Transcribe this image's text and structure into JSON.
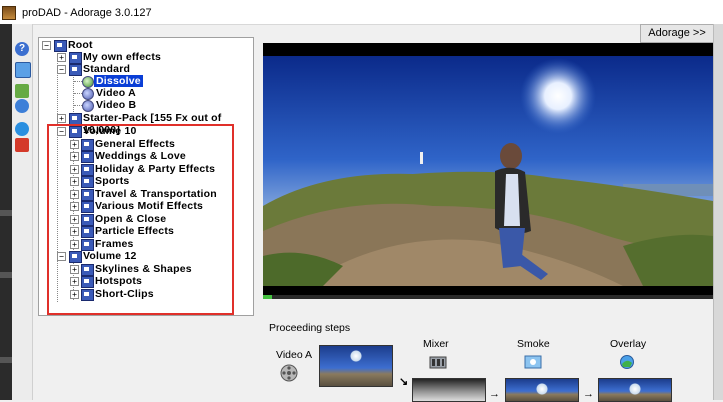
{
  "window": {
    "title": "proDAD - Adorage 3.0.127"
  },
  "toolbar": {
    "adorage_button": "Adorage >>"
  },
  "tree": {
    "root": "Root",
    "my_own_effects": "My own effects",
    "standard": "Standard",
    "dissolve": "Dissolve",
    "video_a": "Video A",
    "video_b": "Video B",
    "starter_pack": "Starter-Pack [155 Fx out of 10,000]",
    "volume10": "Volume 10",
    "volume10_items": [
      "General Effects",
      "Weddings & Love",
      "Holiday & Party Effects",
      "Sports",
      "Travel & Transportation",
      "Various Motif Effects",
      "Open & Close",
      "Particle Effects",
      "Frames"
    ],
    "volume12": "Volume 12",
    "volume12_items": [
      "Skylines & Shapes",
      "Hotspots",
      "Short-Clips"
    ]
  },
  "preview": {
    "progress": 0.02
  },
  "steps": {
    "title": "Proceeding steps",
    "video_a": "Video A",
    "mixer": "Mixer",
    "smoke": "Smoke",
    "overlay": "Overlay"
  },
  "icons": [
    "app-icon",
    "help-icon",
    "monitor-icon",
    "effects-icon",
    "globe-icon",
    "record-icon",
    "folder-icon",
    "film-reel-icon",
    "mixer-icon",
    "smoke-icon",
    "overlay-icon"
  ]
}
